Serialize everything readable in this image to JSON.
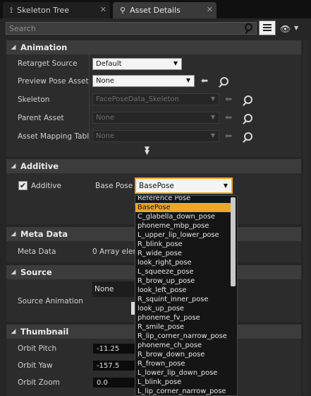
{
  "tabs": [
    {
      "label": "Skeleton Tree",
      "active": false
    },
    {
      "label": "Asset Details",
      "active": true
    }
  ],
  "search": {
    "placeholder": "Search"
  },
  "sections": {
    "animation": "Animation",
    "additive": "Additive",
    "meta_data": "Meta Data",
    "source": "Source",
    "thumbnail": "Thumbnail"
  },
  "animation": {
    "retarget_source": {
      "label": "Retarget Source",
      "value": "Default"
    },
    "preview_pose_asset": {
      "label": "Preview Pose Asset",
      "value": "None"
    },
    "skeleton": {
      "label": "Skeleton",
      "value": "FacePoseData_Skeleton"
    },
    "parent_asset": {
      "label": "Parent Asset",
      "value": "None"
    },
    "asset_mapping_table": {
      "label": "Asset Mapping Tabl",
      "value": "None"
    }
  },
  "additive": {
    "checkbox_label": "Additive",
    "checked": true,
    "base_pose_label": "Base Pose",
    "base_pose_value": "BasePose"
  },
  "meta_data": {
    "label": "Meta Data",
    "value": "0 Array elem"
  },
  "source": {
    "label": "Source Animation",
    "value": "None"
  },
  "thumbnail": {
    "orbit_pitch": {
      "label": "Orbit Pitch",
      "value": "-11.25"
    },
    "orbit_yaw": {
      "label": "Orbit Yaw",
      "value": "-157.5"
    },
    "orbit_zoom": {
      "label": "Orbit Zoom",
      "value": "0.0"
    }
  },
  "dropdown": {
    "selected": "BasePose",
    "items": [
      "Reference Pose",
      "BasePose",
      "C_glabella_down_pose",
      "phoneme_mbp_pose",
      "L_upper_lip_lower_pose",
      "R_blink_pose",
      "R_wide_pose",
      "look_right_pose",
      "L_squeeze_pose",
      "R_brow_up_pose",
      "look_left_pose",
      "R_squint_inner_pose",
      "look_up_pose",
      "phoneme_fv_pose",
      "R_smile_pose",
      "R_lip_corner_narrow_pose",
      "phoneme_ch_pose",
      "R_brow_down_pose",
      "R_frown_pose",
      "L_lower_lip_down_pose",
      "L_blink_pose",
      "L_lip_corner_narrow_pose"
    ]
  },
  "colors": {
    "selection": "#f0a428",
    "section_header": "#3c3c3c",
    "panel": "#2c2c2c"
  },
  "icons": [
    "skeleton-icon",
    "details-icon",
    "close-icon",
    "search-icon",
    "view-options-icon",
    "eye-icon",
    "collapse-triangle-icon",
    "use-selected-arrow-icon",
    "browse-icon",
    "expand-chevron-icon",
    "checkbox-icon"
  ]
}
